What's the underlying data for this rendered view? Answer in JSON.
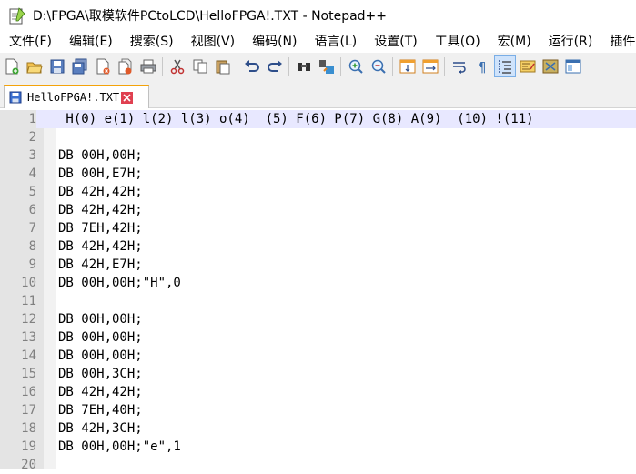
{
  "window": {
    "title": "D:\\FPGA\\取模软件PCtoLCD\\HelloFPGA!.TXT - Notepad++"
  },
  "menu": {
    "items": [
      {
        "label": "文件(F)"
      },
      {
        "label": "编辑(E)"
      },
      {
        "label": "搜索(S)"
      },
      {
        "label": "视图(V)"
      },
      {
        "label": "编码(N)"
      },
      {
        "label": "语言(L)"
      },
      {
        "label": "设置(T)"
      },
      {
        "label": "工具(O)"
      },
      {
        "label": "宏(M)"
      },
      {
        "label": "运行(R)"
      },
      {
        "label": "插件"
      }
    ]
  },
  "toolbar": {
    "icons": [
      "new-file-icon",
      "open-file-icon",
      "save-icon",
      "save-all-icon",
      "close-icon",
      "close-all-icon",
      "print-icon",
      "cut-icon",
      "copy-icon",
      "paste-icon",
      "undo-icon",
      "redo-icon",
      "find-icon",
      "replace-icon",
      "zoom-in-icon",
      "zoom-out-icon",
      "sync-vertical-icon",
      "sync-horizontal-icon",
      "word-wrap-icon",
      "show-all-chars-icon",
      "indent-guide-icon",
      "doc-map-icon",
      "function-list-icon",
      "folder-workspace-icon"
    ]
  },
  "tabs": [
    {
      "label": "HelloFPGA!.TXT",
      "active": true
    }
  ],
  "editor": {
    "current_line": 1,
    "lines": [
      {
        "n": "1",
        "text": " H(0) e(1) l(2) l(3) o(4)  (5) F(6) P(7) G(8) A(9)  (10) !(11)"
      },
      {
        "n": "2",
        "text": ""
      },
      {
        "n": "3",
        "text": "DB 00H,00H;"
      },
      {
        "n": "4",
        "text": "DB 00H,E7H;"
      },
      {
        "n": "5",
        "text": "DB 42H,42H;"
      },
      {
        "n": "6",
        "text": "DB 42H,42H;"
      },
      {
        "n": "7",
        "text": "DB 7EH,42H;"
      },
      {
        "n": "8",
        "text": "DB 42H,42H;"
      },
      {
        "n": "9",
        "text": "DB 42H,E7H;"
      },
      {
        "n": "10",
        "text": "DB 00H,00H;\"H\",0"
      },
      {
        "n": "11",
        "text": ""
      },
      {
        "n": "12",
        "text": "DB 00H,00H;"
      },
      {
        "n": "13",
        "text": "DB 00H,00H;"
      },
      {
        "n": "14",
        "text": "DB 00H,00H;"
      },
      {
        "n": "15",
        "text": "DB 00H,3CH;"
      },
      {
        "n": "16",
        "text": "DB 42H,42H;"
      },
      {
        "n": "17",
        "text": "DB 7EH,40H;"
      },
      {
        "n": "18",
        "text": "DB 42H,3CH;"
      },
      {
        "n": "19",
        "text": "DB 00H,00H;\"e\",1"
      },
      {
        "n": "20",
        "text": ""
      }
    ]
  }
}
